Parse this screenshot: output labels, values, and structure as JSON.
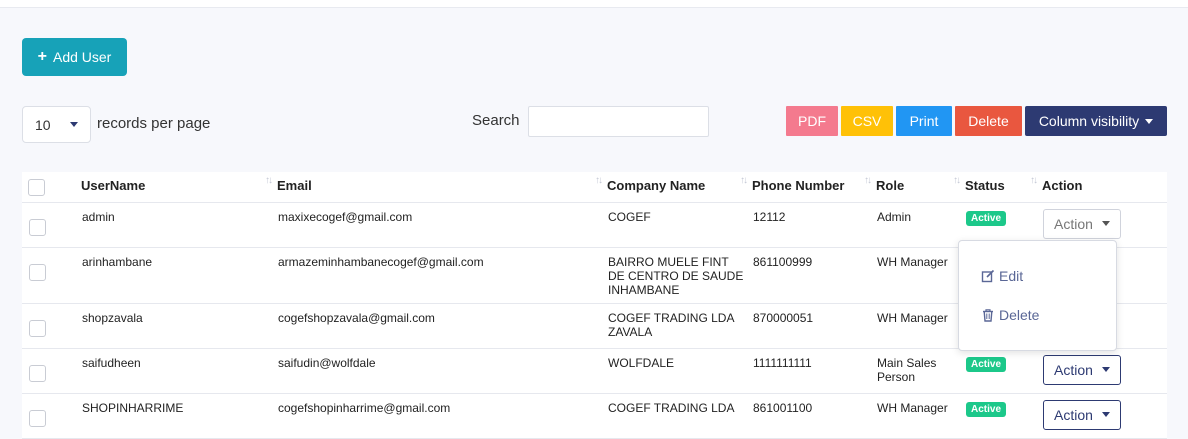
{
  "toolbar": {
    "add_user_label": "Add User",
    "length_value": "10",
    "length_label": "records per page",
    "search_label": "Search",
    "search_value": "",
    "pdf": "PDF",
    "csv": "CSV",
    "print": "Print",
    "delete": "Delete",
    "column_visibility": "Column visibility"
  },
  "table": {
    "headers": [
      "UserName",
      "Email",
      "Company Name",
      "Phone Number",
      "Role",
      "Status",
      "Action"
    ],
    "rows": [
      {
        "username": "admin",
        "email": "maxixecogef@gmail.com",
        "company": "COGEF",
        "phone": "12112",
        "role": "Admin",
        "status": "Active",
        "action": "Action"
      },
      {
        "username": "arinhambane",
        "email": "armazeminhambanecogef@gmail.com",
        "company": "BAIRRO MUELE FINT DE CENTRO DE SAUDE INHAMBANE",
        "phone": "861100999",
        "role": "WH Manager",
        "status": "",
        "action": ""
      },
      {
        "username": "shopzavala",
        "email": "cogefshopzavala@gmail.com",
        "company": "COGEF TRADING LDA ZAVALA",
        "phone": "870000051",
        "role": "WH Manager",
        "status": "",
        "action": ""
      },
      {
        "username": "saifudheen",
        "email": "saifudin@wolfdale",
        "company": "WOLFDALE",
        "phone": "1111111111",
        "role": "Main Sales Person",
        "status": "Active",
        "action": "Action"
      },
      {
        "username": "SHOPINHARRIME",
        "email": "cogefshopinharrime@gmail.com",
        "company": "COGEF TRADING LDA",
        "phone": "861001100",
        "role": "WH Manager",
        "status": "Active",
        "action": "Action"
      }
    ]
  },
  "dropdown": {
    "edit": "Edit",
    "delete": "Delete"
  },
  "colors": {
    "primary": "#2d3a72",
    "teal": "#17a2b8",
    "active_badge": "#1cc88a"
  }
}
